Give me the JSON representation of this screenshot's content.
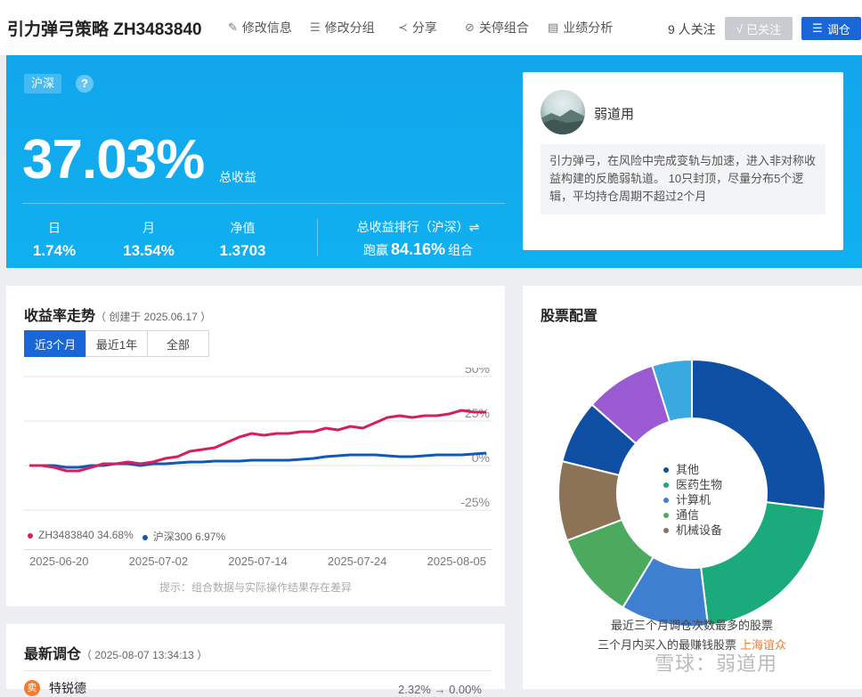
{
  "header": {
    "title": "引力弹弓策略 ZH3483840",
    "actions": [
      {
        "label": "修改信息",
        "icon": "pencil-icon",
        "glyph": "✎"
      },
      {
        "label": "修改分组",
        "icon": "list-icon",
        "glyph": "☰"
      },
      {
        "label": "分享",
        "icon": "share-icon",
        "glyph": "≺"
      },
      {
        "label": "关停组合",
        "icon": "stop-icon",
        "glyph": "⊘"
      },
      {
        "label": "业绩分析",
        "icon": "report-icon",
        "glyph": "▤"
      }
    ],
    "follow_count": "9 人关注",
    "followed_label": "已关注",
    "followed_icon": "√",
    "rebalance_label": "调仓",
    "rebalance_icon": "☰"
  },
  "summary": {
    "market_tag": "沪深",
    "help_icon": "?",
    "total_return": "37.03%",
    "total_return_label": "总收益",
    "day_label": "日",
    "day_value": "1.74%",
    "month_label": "月",
    "month_value": "13.54%",
    "nav_label": "净值",
    "nav_value": "1.3703",
    "rank_label": "总收益排行（沪深）⇌",
    "rank_prefix": "跑赢",
    "rank_value": "84.16%",
    "rank_suffix": "组合"
  },
  "owner": {
    "name": "弱道用",
    "description": "引力弹弓，在风险中完成变轨与加速，进入非对称收益构建的反脆弱轨道。 10只封顶，尽量分布5个逻辑，平均持仓周期不超过2个月"
  },
  "trend": {
    "title": "收益率走势",
    "created": "（ 创建于 2025.06.17 ）",
    "tabs": [
      "近3个月",
      "最近1年",
      "全部"
    ],
    "active_tab": 0,
    "hint": "提示：组合数据与实际操作结果存在差异"
  },
  "chart_data": {
    "type": "line",
    "x": [
      "2025-06-17",
      "2025-06-18",
      "2025-06-19",
      "2025-06-20",
      "2025-06-23",
      "2025-06-24",
      "2025-06-25",
      "2025-06-26",
      "2025-06-27",
      "2025-06-30",
      "2025-07-01",
      "2025-07-02",
      "2025-07-03",
      "2025-07-04",
      "2025-07-07",
      "2025-07-08",
      "2025-07-09",
      "2025-07-10",
      "2025-07-11",
      "2025-07-14",
      "2025-07-15",
      "2025-07-16",
      "2025-07-17",
      "2025-07-18",
      "2025-07-21",
      "2025-07-22",
      "2025-07-23",
      "2025-07-24",
      "2025-07-25",
      "2025-07-28",
      "2025-07-29",
      "2025-07-30",
      "2025-07-31",
      "2025-08-01",
      "2025-08-04",
      "2025-08-05",
      "2025-08-06",
      "2025-08-07"
    ],
    "x_ticks": [
      "2025-06-20",
      "2025-07-02",
      "2025-07-14",
      "2025-07-24",
      "2025-08-05"
    ],
    "series": [
      {
        "name": "ZH3483840",
        "legend_value": "34.68%",
        "color": "#d81e5b",
        "values": [
          0,
          0,
          -1,
          -3,
          -3,
          -1,
          1,
          1,
          2,
          1,
          2,
          4,
          5,
          8,
          9,
          10,
          13,
          16,
          18,
          17,
          18,
          18,
          19,
          19,
          21,
          20,
          22,
          21,
          24,
          27,
          28,
          27,
          28,
          28,
          29,
          31,
          30,
          30
        ]
      },
      {
        "name": "沪深300",
        "legend_value": "6.97%",
        "color": "#1059b7",
        "values": [
          0,
          0,
          0,
          -1,
          -1,
          0,
          0,
          1,
          1,
          0,
          1,
          1,
          1.5,
          2,
          2,
          2.5,
          2.5,
          2.5,
          3,
          3,
          3,
          3,
          3.5,
          4,
          5,
          5.5,
          6,
          6,
          6,
          5.5,
          5,
          5,
          5.5,
          6,
          6,
          6,
          6.5,
          7
        ]
      }
    ],
    "y_ticks": [
      "50%",
      "25%",
      "0%",
      "-25%"
    ],
    "ylim": [
      -25,
      50
    ],
    "grid": true,
    "legend": "bottom-left"
  },
  "allocation": {
    "title": "股票配置",
    "chart_type": "pie",
    "slices": [
      {
        "name": "其他",
        "value": 28,
        "color": "#0e4fa3",
        "legend": true
      },
      {
        "name": "医药生物",
        "value": 22,
        "color": "#1aaa7c",
        "legend": true
      },
      {
        "name": "计算机",
        "value": 11,
        "color": "#3f7fcf",
        "legend": true
      },
      {
        "name": "通信",
        "value": 11,
        "color": "#4caa5e",
        "legend": true
      },
      {
        "name": "机械设备",
        "value": 10,
        "color": "#8c7356",
        "legend": true
      },
      {
        "name": "",
        "value": 8,
        "color": "#0e4fa3",
        "legend": false
      },
      {
        "name": "",
        "value": 9,
        "color": "#9a5bd2",
        "legend": false
      },
      {
        "name": "",
        "value": 5,
        "color": "#3aa9e0",
        "legend": false
      }
    ],
    "footer_line1": "最近三个月调仓次数最多的股票",
    "footer_line2": "三个月内买入的最赚钱股票",
    "footer_link": "上海谊众"
  },
  "latest": {
    "title": "最新调仓",
    "time": "（ 2025-08-07 13:34:13 ）",
    "stock_name": "特锐德",
    "stock_icon": "卖",
    "from_to": "2.32% → 0.00%"
  },
  "watermark": "雪球：弱道用"
}
